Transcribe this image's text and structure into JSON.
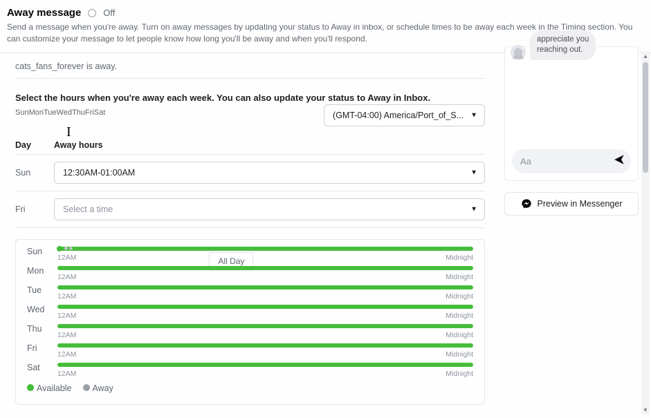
{
  "header": {
    "title": "Away message",
    "toggle_state": "Off",
    "description": "Send a message when you're away. Turn on away messages by updating your status to Away in inbox, or schedule times to be away each week in the Timing section. You can customize your message to let people know how long you'll be away and when you'll respond."
  },
  "status_line": "cats_fans_forever is away.",
  "schedule": {
    "title": "Select the hours when you're away each week. You can also update your status to Away in Inbox.",
    "days_short": [
      "Sun",
      "Mon",
      "Tue",
      "Wed",
      "Thu",
      "Fri",
      "Sat"
    ],
    "timezone_display": "(GMT-04:00) America/Port_of_S...",
    "columns": {
      "day": "Day",
      "hours": "Away hours"
    },
    "rows": [
      {
        "day": "Sun",
        "value": "12:30AM-01:00AM"
      },
      {
        "day": "Fri",
        "value": "",
        "placeholder": "Select a time"
      }
    ],
    "allday_tooltip": "All Day",
    "timeline": {
      "days": [
        {
          "label": "Sun",
          "partial": true,
          "start": "12AM",
          "end": "Midnight"
        },
        {
          "label": "Mon",
          "partial": false,
          "start": "12AM",
          "end": "Midnight"
        },
        {
          "label": "Tue",
          "partial": false,
          "start": "12AM",
          "end": "Midnight"
        },
        {
          "label": "Wed",
          "partial": false,
          "start": "12AM",
          "end": "Midnight"
        },
        {
          "label": "Thu",
          "partial": false,
          "start": "12AM",
          "end": "Midnight"
        },
        {
          "label": "Fri",
          "partial": false,
          "start": "12AM",
          "end": "Midnight"
        },
        {
          "label": "Sat",
          "partial": false,
          "start": "12AM",
          "end": "Midnight"
        }
      ]
    },
    "legend": {
      "available": "Available",
      "away": "Away"
    }
  },
  "preview": {
    "message_snippet_1": "appreciate you",
    "message_snippet_2": "reaching out.",
    "compose_placeholder": "Aa",
    "button_label": "Preview in Messenger"
  }
}
